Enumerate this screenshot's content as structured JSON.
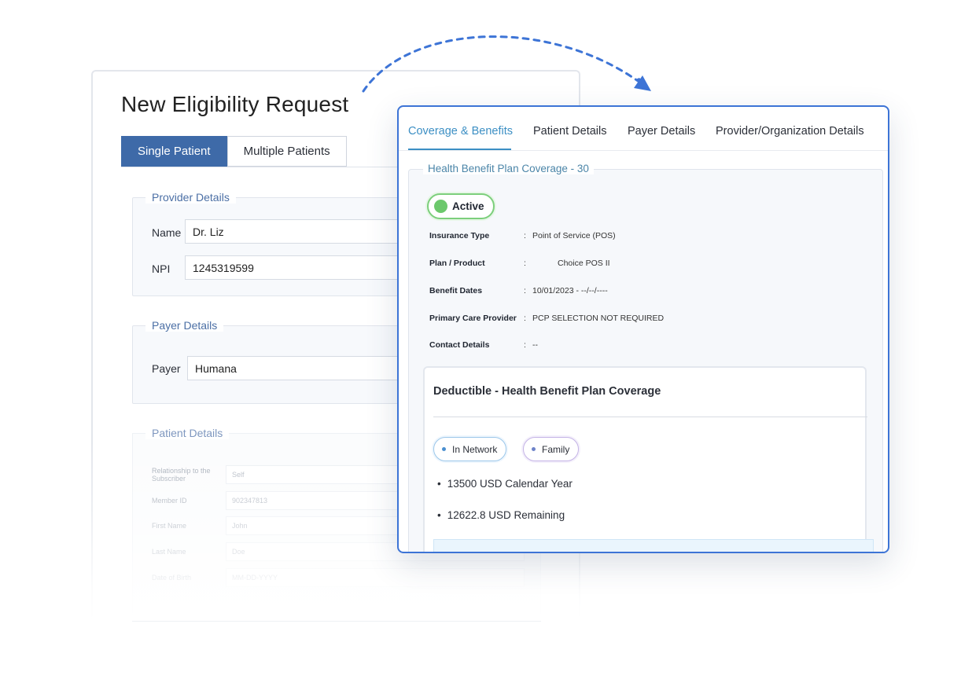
{
  "form": {
    "title": "New Eligibility Request",
    "tabs": [
      "Single Patient",
      "Multiple Patients"
    ],
    "provider": {
      "legend": "Provider Details",
      "name_label": "Name",
      "name_value": "Dr. Liz",
      "npi_label": "NPI",
      "npi_value": "1245319599"
    },
    "payer": {
      "legend": "Payer Details",
      "payer_label": "Payer",
      "payer_value": "Humana"
    },
    "patient": {
      "legend": "Patient Details",
      "relationship_label": "Relationship to the Subscriber",
      "relationship_value": "Self",
      "member_id_label": "Member ID",
      "member_id_value": "902347813",
      "first_name_label": "First Name",
      "first_name_value": "John",
      "last_name_label": "Last Name",
      "last_name_value": "Doe",
      "dob_label": "Date of Birth",
      "dob_placeholder": "MM-DD-YYYY"
    }
  },
  "panel": {
    "tabs": [
      "Coverage & Benefits",
      "Patient Details",
      "Payer Details",
      "Provider/Organization Details"
    ],
    "coverage": {
      "legend": "Health Benefit Plan Coverage - 30",
      "status": "Active",
      "colon": ":",
      "rows": [
        {
          "label": "Insurance Type",
          "value": "Point of Service (POS)"
        },
        {
          "label": "Plan / Product",
          "value": "Choice POS II"
        },
        {
          "label": "Benefit Dates",
          "value": "10/01/2023 - --/--/----"
        },
        {
          "label": "Primary Care Provider",
          "value": "PCP SELECTION NOT REQUIRED"
        },
        {
          "label": "Contact Details",
          "value": "--"
        }
      ]
    },
    "deductible": {
      "title": "Deductible - Health Benefit Plan Coverage",
      "chips": [
        "In Network",
        "Family"
      ],
      "items": [
        "13500 USD Calendar Year",
        "12622.8 USD Remaining"
      ]
    }
  },
  "colors": {
    "accent_blue": "#3d74d6",
    "tab_active": "#3c8fc4",
    "active_green": "#6cc86c",
    "primary_tab": "#3e6aa8"
  }
}
